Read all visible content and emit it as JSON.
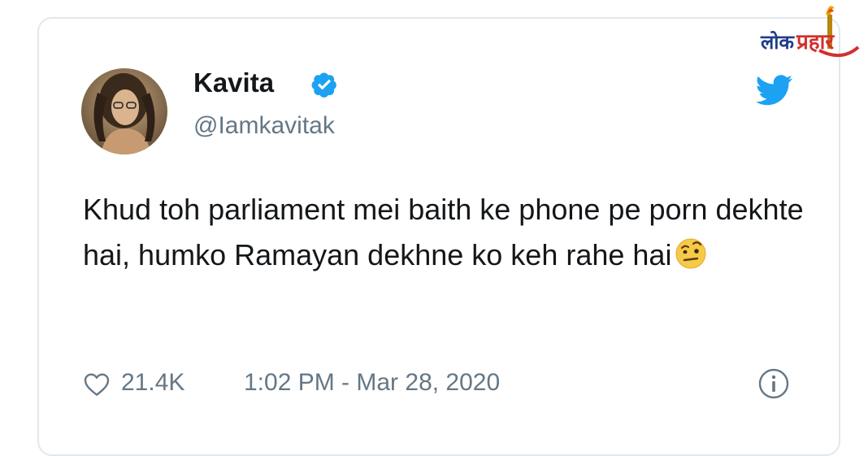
{
  "tweet": {
    "display_name": "Kavita",
    "handle": "@Iamkavitak",
    "text": "Khud toh parliament mei baith ke phone pe porn dekhte hai, humko Ramayan dekhne ko keh rahe hai",
    "emoji": "face-with-raised-eyebrow",
    "likes": "21.4K",
    "timestamp": "1:02 PM - Mar 28, 2020"
  },
  "watermark": {
    "text_left": "लोक",
    "text_right": "प्रहार"
  },
  "colors": {
    "text_primary": "#14171a",
    "text_secondary": "#657786",
    "twitter_blue": "#1da1f2",
    "border": "#e1e8ed",
    "watermark_blue": "#1f3c88",
    "watermark_red": "#d32f2f"
  },
  "icons": [
    "verified-icon",
    "twitter-bird-icon",
    "heart-icon",
    "info-icon",
    "avatar"
  ]
}
